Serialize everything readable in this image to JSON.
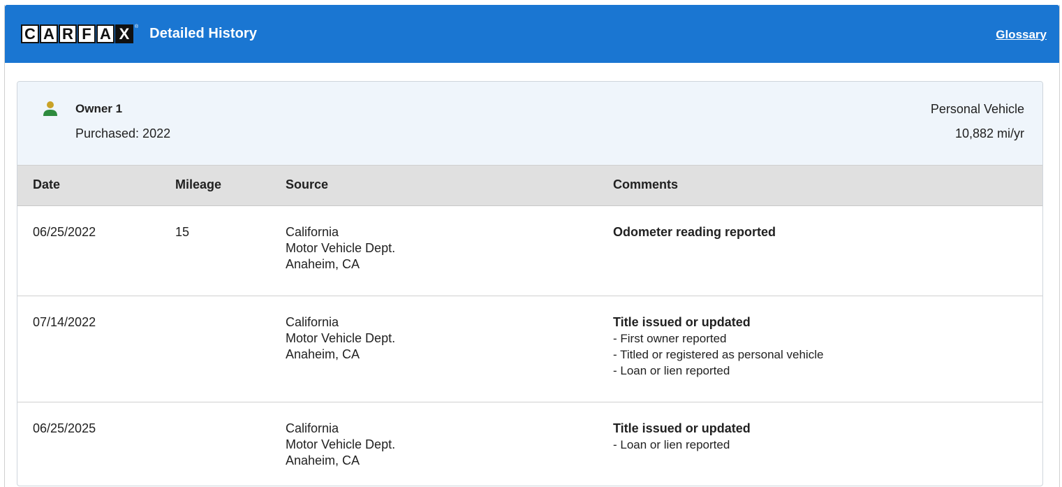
{
  "header": {
    "logo_letters": [
      "C",
      "A",
      "R",
      "F",
      "A",
      "X"
    ],
    "title": "Detailed History",
    "glossary_link": "Glossary",
    "brand_color": "#1a76d2"
  },
  "owner": {
    "icon": "person-icon",
    "name": "Owner 1",
    "purchased": "Purchased: 2022",
    "vehicle_type": "Personal Vehicle",
    "mileage_per_year": "10,882 mi/yr"
  },
  "table": {
    "columns": [
      "Date",
      "Mileage",
      "Source",
      "Comments"
    ],
    "rows": [
      {
        "date": "06/25/2022",
        "mileage": "15",
        "source": [
          "California",
          "Motor Vehicle Dept.",
          "Anaheim, CA"
        ],
        "comment_title": "Odometer reading reported",
        "comment_items": []
      },
      {
        "date": "07/14/2022",
        "mileage": "",
        "source": [
          "California",
          "Motor Vehicle Dept.",
          "Anaheim, CA"
        ],
        "comment_title": "Title issued or updated",
        "comment_items": [
          "- First owner reported",
          "- Titled or registered as personal vehicle",
          "- Loan or lien reported"
        ]
      },
      {
        "date": "06/25/2025",
        "mileage": "",
        "source": [
          "California",
          "Motor Vehicle Dept.",
          "Anaheim, CA"
        ],
        "comment_title": "Title issued or updated",
        "comment_items": [
          "- Loan or lien reported"
        ]
      }
    ]
  }
}
